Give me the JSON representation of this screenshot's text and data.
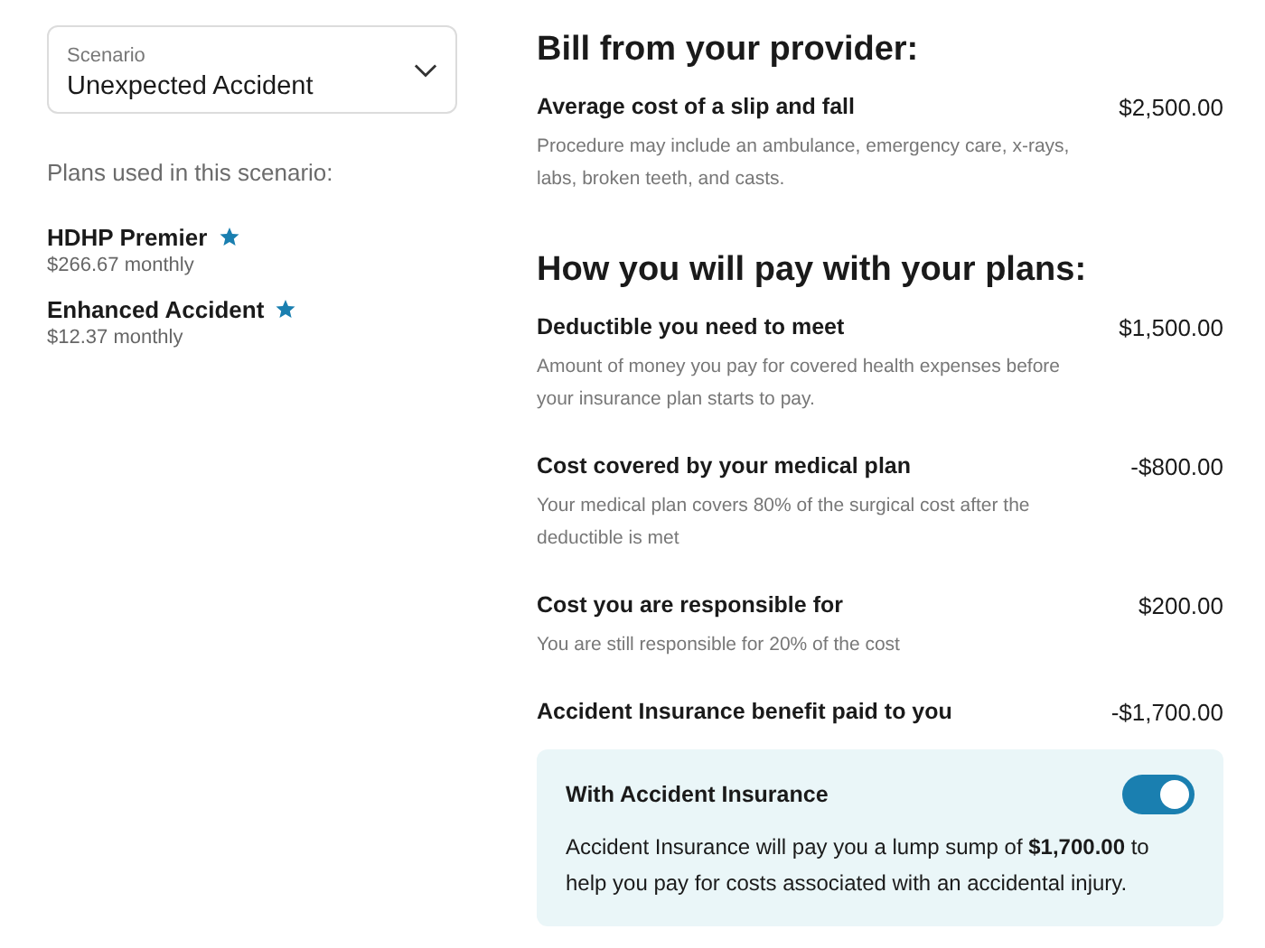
{
  "scenario_select": {
    "label": "Scenario",
    "value": "Unexpected Accident"
  },
  "plans_heading": "Plans used in this scenario:",
  "plans": [
    {
      "name": "HDHP Premier",
      "starred": true,
      "price": "$266.67 monthly"
    },
    {
      "name": "Enhanced Accident",
      "starred": true,
      "price": "$12.37 monthly"
    }
  ],
  "bill_section": {
    "heading": "Bill from your provider:",
    "items": [
      {
        "title": "Average cost of a slip and fall",
        "amount": "$2,500.00",
        "description": "Procedure may include an ambulance, emergency care, x-rays, labs, broken teeth, and casts."
      }
    ]
  },
  "pay_section": {
    "heading": "How you will pay with your plans:",
    "items": [
      {
        "title": "Deductible you need to meet",
        "amount": "$1,500.00",
        "description": "Amount of money you pay for covered health expenses before your insurance plan starts to pay."
      },
      {
        "title": "Cost covered by your medical plan",
        "amount": "-$800.00",
        "description": "Your medical plan covers 80% of the surgical cost after the deductible is met"
      },
      {
        "title": "Cost you are responsible for",
        "amount": "$200.00",
        "description": "You are still responsible for 20% of the cost"
      },
      {
        "title": "Accident Insurance benefit paid to you",
        "amount": "-$1,700.00"
      }
    ]
  },
  "insurance_card": {
    "title": "With Accident Insurance",
    "on": true,
    "text": "Accident Insurance will pay you a lump sump of **$1,700.00** to help you pay for costs associated with an accidental injury."
  }
}
